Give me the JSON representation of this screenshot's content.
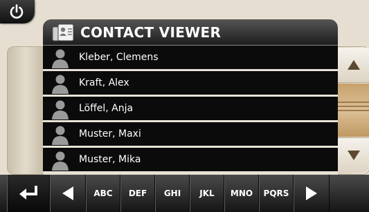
{
  "header": {
    "title": "CONTACT VIEWER"
  },
  "contacts": [
    {
      "name": "Kleber, Clemens"
    },
    {
      "name": "Kraft, Alex"
    },
    {
      "name": "Löffel, Anja"
    },
    {
      "name": "Muster, Maxi"
    },
    {
      "name": "Muster, Mika"
    }
  ],
  "keyboard": {
    "groups": [
      "ABC",
      "DEF",
      "GHI",
      "JKL",
      "MNO",
      "PQRS"
    ]
  },
  "icons": {
    "power": "power-icon",
    "contacts": "contact-card-icon",
    "person": "person-icon",
    "up": "arrow-up-icon",
    "down": "arrow-down-icon",
    "back": "return-arrow-icon",
    "prev": "arrow-left-icon",
    "next": "arrow-right-icon"
  },
  "colors": {
    "background": "#e6dfd1",
    "header": "#1c1c1c",
    "list": "#0b0b0b",
    "scroll_thumb": "#dcc097"
  }
}
